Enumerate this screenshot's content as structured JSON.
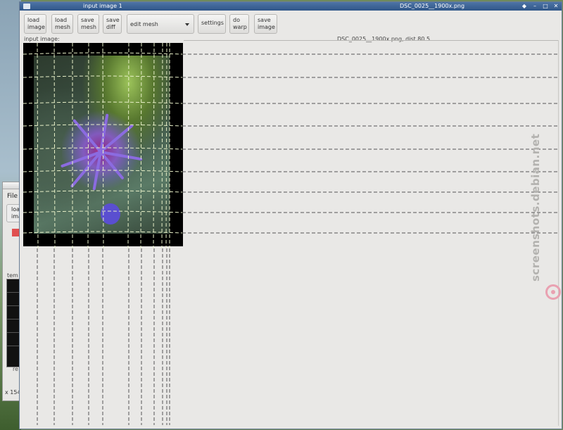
{
  "main_window": {
    "title_left": "input image 1",
    "title_right": "DSC_0025__1900x.png",
    "controls": [
      "◆",
      "–",
      "□",
      "✕"
    ]
  },
  "toolbar": {
    "buttons": [
      {
        "line1": "load",
        "line2": "image"
      },
      {
        "line1": "load",
        "line2": "mesh"
      },
      {
        "line1": "save",
        "line2": "mesh"
      },
      {
        "line1": "save",
        "line2": "diff"
      }
    ],
    "mode_select": "edit mesh",
    "settings": "settings",
    "do_warp": {
      "line1": "do",
      "line2": "warp"
    },
    "save_image": {
      "line1": "save",
      "line2": "image"
    }
  },
  "labels": {
    "input_image": "input image:",
    "file_info": "DSC_0025__1900x.png, dist 80.5"
  },
  "back_window": {
    "menu_file": "File",
    "button_text": "load imag",
    "side_label": "tem",
    "r_label": "re",
    "coord": "x 154"
  },
  "watermark": {
    "text": "screenshots.debian.net"
  },
  "colors": {
    "titlebar": "#2f5688",
    "window_bg": "#e9e8e6",
    "mesh_line_light": "#e8f0c8",
    "mesh_line_dark": "#555555"
  }
}
